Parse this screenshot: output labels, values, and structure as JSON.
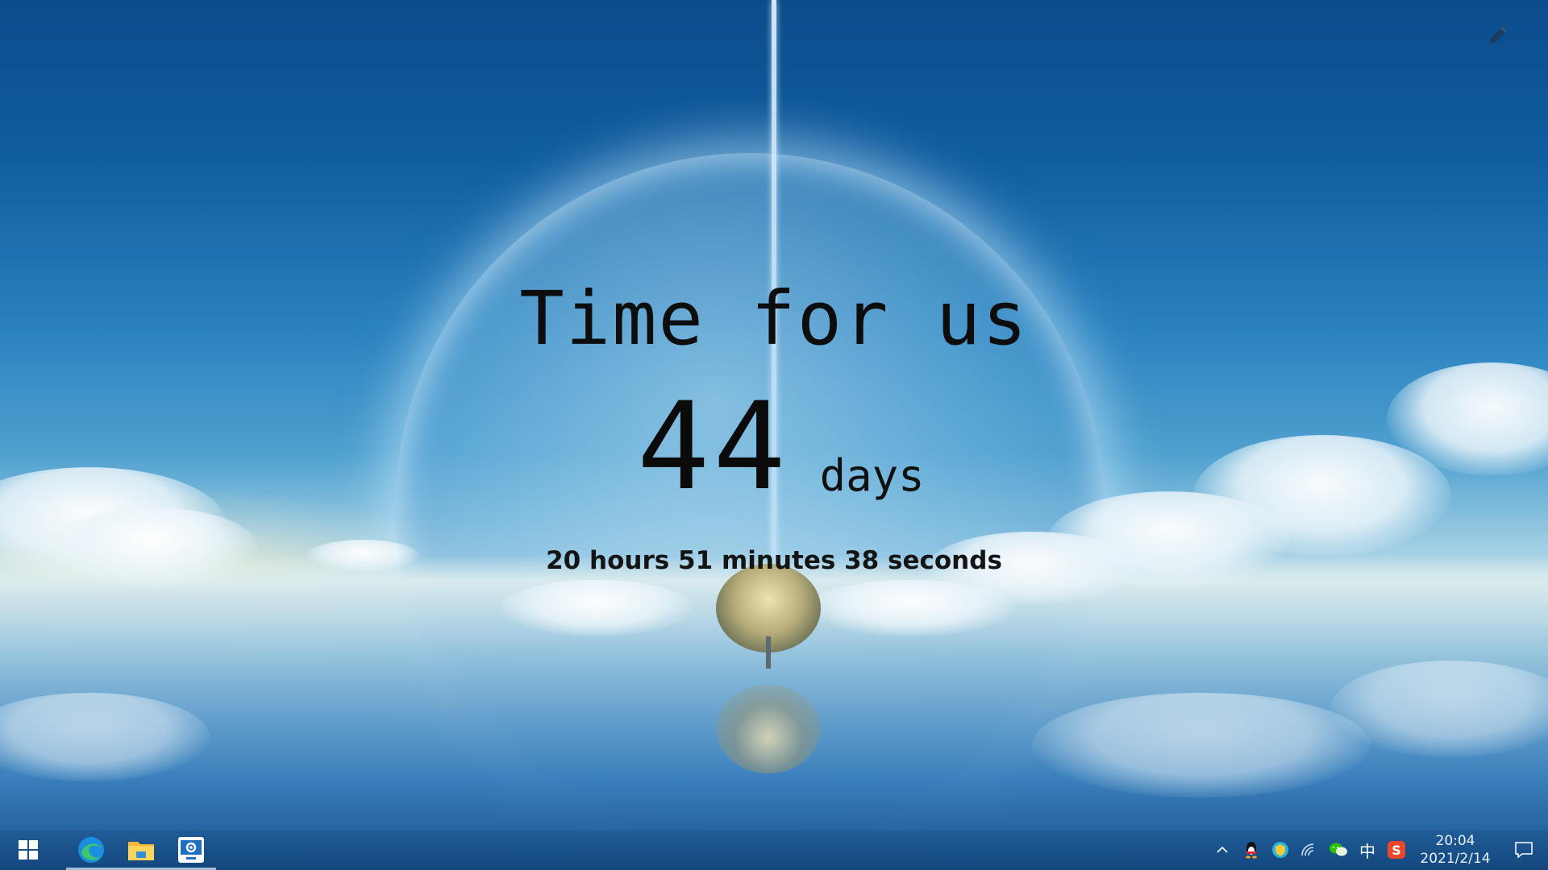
{
  "countdown": {
    "title": "Time for us",
    "days_value": "44",
    "days_unit": "days",
    "remaining": "20 hours 51 minutes 38 seconds"
  },
  "taskbar": {
    "start": "start-icon",
    "pinned": [
      {
        "name": "edge-icon",
        "running": true
      },
      {
        "name": "file-explorer-icon",
        "running": true
      },
      {
        "name": "wallpaper-settings-icon",
        "running": true
      }
    ]
  },
  "tray": {
    "chevron": "^",
    "ime": "中",
    "sogou": "S",
    "clock_time": "20:04",
    "clock_date": "2021/2/14"
  },
  "colors": {
    "accent": "#1a8ee0",
    "text_dark": "#0d0d0d"
  }
}
